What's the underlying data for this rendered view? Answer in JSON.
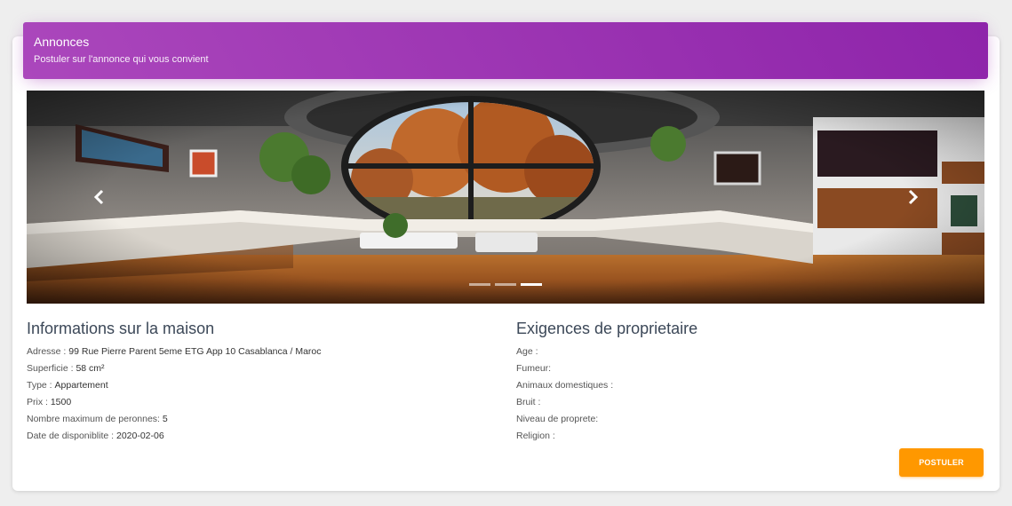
{
  "header": {
    "title": "Annonces",
    "subtitle": "Postuler sur l'annonce qui vous convient"
  },
  "carousel": {
    "slide_count": 3,
    "active_index": 2,
    "prev_icon": "chevron-left-icon",
    "next_icon": "chevron-right-icon"
  },
  "house": {
    "title": "Informations sur la maison",
    "rows": [
      {
        "label": "Adresse : ",
        "value": "99 Rue Pierre Parent 5eme ETG App 10 Casablanca / Maroc"
      },
      {
        "label": "Superficie : ",
        "value": "58 cm²"
      },
      {
        "label": "Type : ",
        "value": "Appartement"
      },
      {
        "label": "Prix : ",
        "value": "1500"
      },
      {
        "label": "Nombre maximum de peronnes: ",
        "value": "5"
      },
      {
        "label": "Date de disponiblite : ",
        "value": "2020-02-06"
      }
    ]
  },
  "owner": {
    "title": "Exigences de proprietaire",
    "rows": [
      {
        "label": "Age : ",
        "value": ""
      },
      {
        "label": "Fumeur: ",
        "value": ""
      },
      {
        "label": "Animaux domestiques : ",
        "value": ""
      },
      {
        "label": "Bruit : ",
        "value": ""
      },
      {
        "label": "Niveau de proprete: ",
        "value": ""
      },
      {
        "label": "Religion : ",
        "value": ""
      }
    ]
  },
  "actions": {
    "postuler_label": "POSTULER"
  },
  "colors": {
    "header_start": "#ab47bc",
    "header_end": "#8e24aa",
    "button": "#ff9800"
  }
}
